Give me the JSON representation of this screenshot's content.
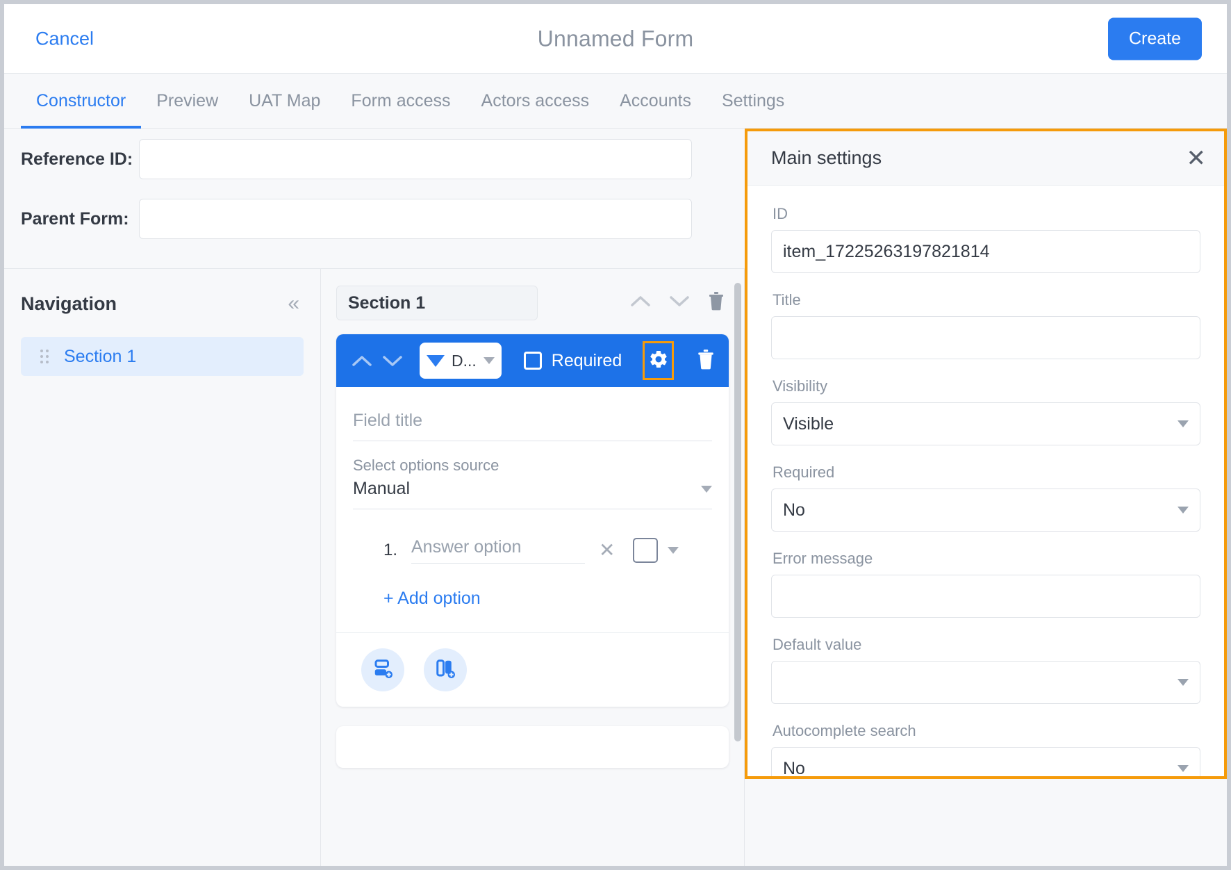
{
  "topbar": {
    "cancel_label": "Cancel",
    "form_title": "Unnamed Form",
    "create_label": "Create"
  },
  "tabs": [
    {
      "label": "Constructor",
      "active": true
    },
    {
      "label": "Preview",
      "active": false
    },
    {
      "label": "UAT Map",
      "active": false
    },
    {
      "label": "Form access",
      "active": false
    },
    {
      "label": "Actors access",
      "active": false
    },
    {
      "label": "Accounts",
      "active": false
    },
    {
      "label": "Settings",
      "active": false
    }
  ],
  "meta": {
    "reference_id_label": "Reference ID:",
    "reference_id_value": "",
    "parent_form_label": "Parent Form:",
    "parent_form_value": ""
  },
  "navigation": {
    "title": "Navigation",
    "collapse_icon": "chevron-double-left-icon",
    "items": [
      {
        "label": "Section 1"
      }
    ]
  },
  "canvas": {
    "section_name": "Section 1",
    "field": {
      "type_label": "D...",
      "required_label": "Required",
      "title_placeholder": "Field title",
      "options_source_label": "Select options source",
      "options_source_value": "Manual",
      "options": [
        {
          "number": "1.",
          "placeholder": "Answer option"
        }
      ],
      "add_option_label": "+ Add option"
    }
  },
  "settings": {
    "title": "Main settings",
    "close_icon": "close-icon",
    "fields": [
      {
        "label": "ID",
        "value": "item_17225263197821814",
        "type": "text"
      },
      {
        "label": "Title",
        "value": "",
        "type": "text"
      },
      {
        "label": "Visibility",
        "value": "Visible",
        "type": "select"
      },
      {
        "label": "Required",
        "value": "No",
        "type": "select"
      },
      {
        "label": "Error message",
        "value": "",
        "type": "text"
      },
      {
        "label": "Default value",
        "value": "",
        "type": "select"
      },
      {
        "label": "Autocomplete search",
        "value": "No",
        "type": "select"
      }
    ]
  },
  "colors": {
    "accent": "#2b7cf0",
    "toolbar_blue": "#1d72e8",
    "highlight_orange": "#f59b0b",
    "panel_bg": "#f7f8fa"
  }
}
